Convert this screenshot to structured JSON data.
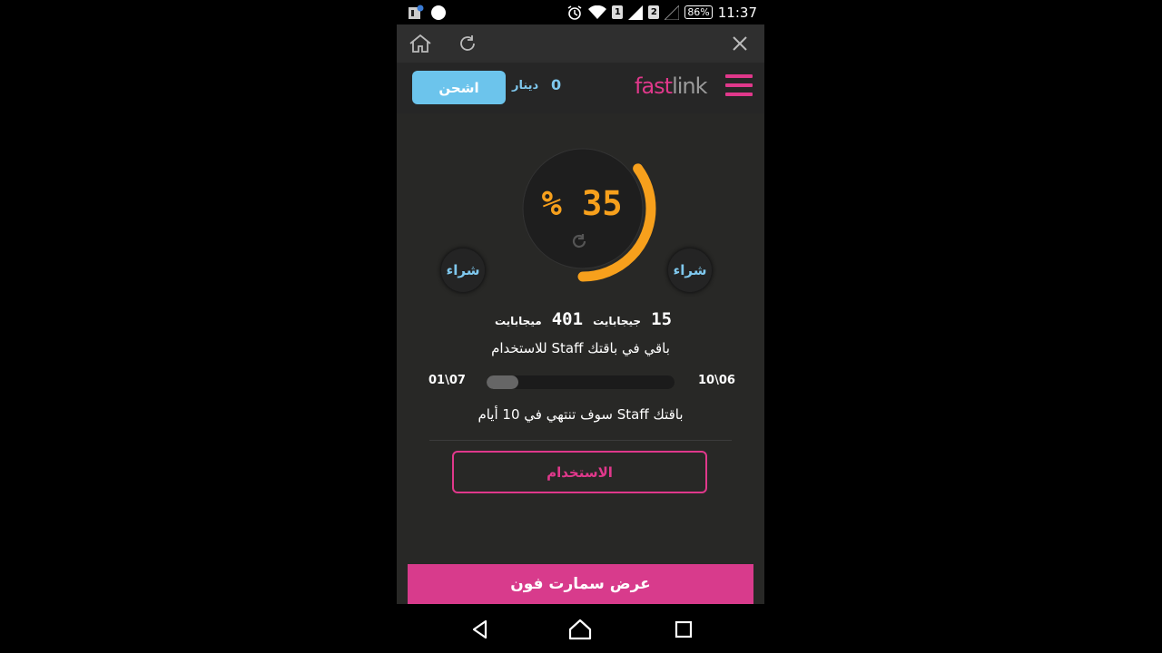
{
  "status_bar": {
    "time": "11:37",
    "battery": "86%",
    "sim1": "1",
    "sim2": "2",
    "icons": [
      "app-notification-icon",
      "circle-notification-icon",
      "alarm-icon",
      "wifi-icon",
      "signal-icon",
      "signal-empty-icon"
    ]
  },
  "browser": {
    "icons": [
      "home-icon",
      "reload-icon",
      "close-icon"
    ]
  },
  "header": {
    "logo_fast": "fast",
    "logo_link": "link",
    "balance": "0",
    "currency": "دينار",
    "charge_label": "اشحن",
    "menu_icon": "hamburger-menu-icon"
  },
  "usage": {
    "percent_label": "% 35",
    "percent": 35,
    "buy_left": "شراء",
    "buy_right": "شراء",
    "gb_value": "15",
    "gb_unit": "جيجابايت",
    "mb_value": "401",
    "mb_unit": "ميجابايت",
    "remaining_text": "باقي في باقتك Staff للاستخدام",
    "start_date": "10\\06",
    "end_date": "01\\07",
    "period_progress": 0.17,
    "expiry_text": "باقتك Staff سوف تنتهي في 10 أيام",
    "use_label": "الاستخدام"
  },
  "promo": {
    "label": "عرض سمارت فون"
  },
  "colors": {
    "accent_pink": "#e0388b",
    "accent_blue": "#6cc4ec",
    "gauge_orange": "#f7a01c"
  },
  "nav": {
    "icons": [
      "back-icon",
      "home-nav-icon",
      "recents-icon"
    ]
  }
}
